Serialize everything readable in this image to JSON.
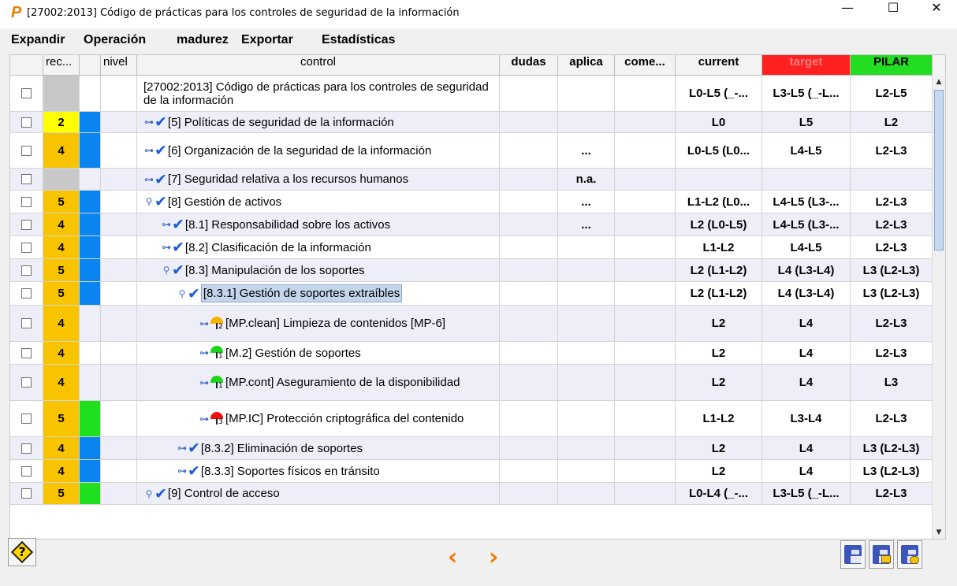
{
  "window": {
    "app_icon": "P",
    "title": "[27002:2013] Código de prácticas para los controles de seguridad de la información",
    "minimize_glyph": "—",
    "maximize_glyph": "☐",
    "close_glyph": "✕"
  },
  "menu": {
    "items": [
      "Expandir",
      "Operación",
      "madurez",
      "Exportar",
      "Estadísticas"
    ]
  },
  "columns": {
    "rec": "rec...",
    "nivel": "nivel",
    "control": "control",
    "dudas": "dudas",
    "aplica": "aplica",
    "comentarios": "come...",
    "current": "current",
    "target": "target",
    "pilar": "PILAR"
  },
  "colors": {
    "target_header": "#ff2020",
    "pilar_header": "#22dd22",
    "rec_yellow": "#ffff00",
    "rec_orange": "#f8c400",
    "rec_gray": "#c8c8c8",
    "nivel_blue": "#0a84f0",
    "nivel_green": "#1ee01e",
    "umbrella_orange": "#f7b200",
    "umbrella_green": "#19d619",
    "umbrella_red": "#ee1010"
  },
  "rows": [
    {
      "rec": "",
      "rec_color": "gray",
      "nivel_color": "",
      "indent": 0,
      "expander": "",
      "icon": "none",
      "control": "[27002:2013] Código de prácticas para los controles de seguridad de la información",
      "aplica": "",
      "current": "L0-L5 (_-...",
      "target": "L3-L5 (_-L...",
      "pilar": "L2-L5"
    },
    {
      "rec": "2",
      "rec_color": "yellow",
      "nivel_color": "blue",
      "indent": 0,
      "expander": "⊶",
      "icon": "check",
      "control": "[5] Políticas de seguridad de la información",
      "aplica": "",
      "current": "L0",
      "target": "L5",
      "pilar": "L2"
    },
    {
      "rec": "4",
      "rec_color": "orange",
      "nivel_color": "blue",
      "indent": 0,
      "expander": "⊶",
      "icon": "check",
      "control": "[6] Organización de la seguridad de la información",
      "aplica": "...",
      "current": "L0-L5 (L0...",
      "target": "L4-L5",
      "pilar": "L2-L3"
    },
    {
      "rec": "",
      "rec_color": "gray",
      "nivel_color": "",
      "indent": 0,
      "expander": "⊶",
      "icon": "check",
      "control": "[7] Seguridad relativa a los recursos humanos",
      "aplica": "n.a.",
      "current": "",
      "target": "",
      "pilar": ""
    },
    {
      "rec": "5",
      "rec_color": "orange",
      "nivel_color": "blue",
      "indent": 0,
      "expander": "⚲",
      "icon": "check",
      "control": "[8] Gestión de activos",
      "aplica": "...",
      "current": "L1-L2 (L0...",
      "target": "L4-L5 (L3-...",
      "pilar": "L2-L3"
    },
    {
      "rec": "4",
      "rec_color": "orange",
      "nivel_color": "blue",
      "indent": 1,
      "expander": "⊶",
      "icon": "check",
      "control": "[8.1] Responsabilidad sobre los activos",
      "aplica": "...",
      "current": "L2 (L0-L5)",
      "target": "L4-L5 (L3-...",
      "pilar": "L2-L3"
    },
    {
      "rec": "4",
      "rec_color": "orange",
      "nivel_color": "blue",
      "indent": 1,
      "expander": "⊶",
      "icon": "check",
      "control": "[8.2] Clasificación de la información",
      "aplica": "",
      "current": "L1-L2",
      "target": "L4-L5",
      "pilar": "L2-L3"
    },
    {
      "rec": "5",
      "rec_color": "orange",
      "nivel_color": "blue",
      "indent": 1,
      "expander": "⚲",
      "icon": "check",
      "control": "[8.3] Manipulación de los soportes",
      "aplica": "",
      "current": "L2 (L1-L2)",
      "target": "L4 (L3-L4)",
      "pilar": "L3 (L2-L3)"
    },
    {
      "rec": "5",
      "rec_color": "orange",
      "nivel_color": "blue",
      "indent": 2,
      "expander": "⚲",
      "icon": "check",
      "control": "[8.3.1] Gestión de soportes extraíbles",
      "aplica": "",
      "current": "L2 (L1-L2)",
      "target": "L4 (L3-L4)",
      "pilar": "L3 (L2-L3)",
      "selected": true
    },
    {
      "rec": "4",
      "rec_color": "orange",
      "nivel_color": "",
      "indent": 3,
      "expander": "⊶",
      "icon": "umbrella-orange",
      "umb_num": "2",
      "control": "[MP.clean] Limpieza de contenidos [MP-6]",
      "aplica": "",
      "current": "L2",
      "target": "L4",
      "pilar": "L2-L3"
    },
    {
      "rec": "4",
      "rec_color": "orange",
      "nivel_color": "",
      "indent": 3,
      "expander": "⊶",
      "icon": "umbrella-green",
      "umb_num": "1",
      "control": "[M.2] Gestión de soportes",
      "aplica": "",
      "current": "L2",
      "target": "L4",
      "pilar": "L2-L3"
    },
    {
      "rec": "4",
      "rec_color": "orange",
      "nivel_color": "",
      "indent": 3,
      "expander": "⊶",
      "icon": "umbrella-green",
      "umb_num": "1",
      "control": "[MP.cont] Aseguramiento de la disponibilidad",
      "aplica": "",
      "current": "L2",
      "target": "L4",
      "pilar": "L3"
    },
    {
      "rec": "5",
      "rec_color": "orange",
      "nivel_color": "green",
      "indent": 3,
      "expander": "⊶",
      "icon": "umbrella-red",
      "umb_num": "3",
      "control": "[MP.IC] Protección criptográfica del contenido",
      "aplica": "",
      "current": "L1-L2",
      "target": "L3-L4",
      "pilar": "L2-L3"
    },
    {
      "rec": "4",
      "rec_color": "orange",
      "nivel_color": "blue",
      "indent": 2,
      "expander": "⊶",
      "icon": "check",
      "control": "[8.3.2] Eliminación de soportes",
      "aplica": "",
      "current": "L2",
      "target": "L4",
      "pilar": "L3 (L2-L3)"
    },
    {
      "rec": "4",
      "rec_color": "orange",
      "nivel_color": "blue",
      "indent": 2,
      "expander": "⊶",
      "icon": "check",
      "control": "[8.3.3] Soportes físicos en tránsito",
      "aplica": "",
      "current": "L2",
      "target": "L4",
      "pilar": "L3 (L2-L3)"
    },
    {
      "rec": "5",
      "rec_color": "orange",
      "nivel_color": "green",
      "indent": 0,
      "expander": "⚲",
      "icon": "check",
      "control": "[9] Control de acceso",
      "aplica": "",
      "current": "L0-L4 (_-...",
      "target": "L3-L5 (_-L...",
      "pilar": "L2-L3"
    }
  ],
  "bottom": {
    "help_icon": "help-diamond-icon",
    "help_glyph": "?",
    "prev_glyph": "‹",
    "next_glyph": "›"
  }
}
